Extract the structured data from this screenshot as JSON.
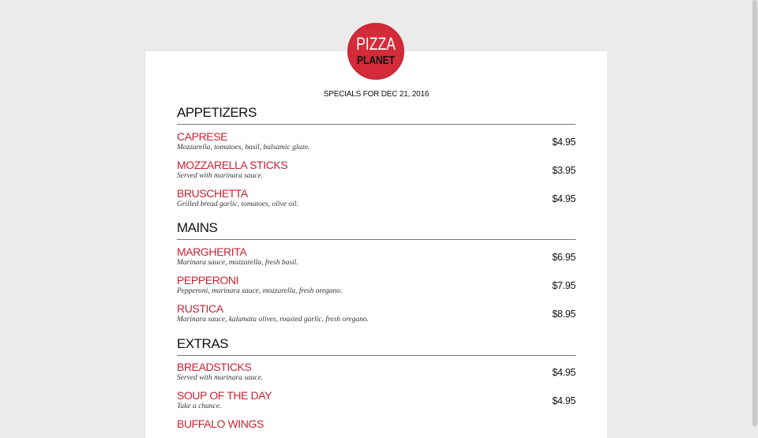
{
  "logo": {
    "line1": "PIZZA",
    "line2": "PLANET"
  },
  "specials": "SPECIALS FOR DEC 21, 2016",
  "colors": {
    "accent": "#d42a3a",
    "item_name": "#c82333"
  },
  "sections": [
    {
      "title": "APPETIZERS",
      "items": [
        {
          "name": "CAPRESE",
          "desc": "Mozzarella, tomatoes, basil, balsamic glaze.",
          "price": "$4.95"
        },
        {
          "name": "MOZZARELLA STICKS",
          "desc": "Served with marinara sauce.",
          "price": "$3.95"
        },
        {
          "name": "BRUSCHETTA",
          "desc": "Grilled bread garlic, tomatoes, olive oil.",
          "price": "$4.95"
        }
      ]
    },
    {
      "title": "MAINS",
      "items": [
        {
          "name": "MARGHERITA",
          "desc": "Marinara sauce, mozzarella, fresh basil.",
          "price": "$6.95"
        },
        {
          "name": "PEPPERONI",
          "desc": "Pepperoni, marinara sauce, mozzarella, fresh oregano.",
          "price": "$7.95"
        },
        {
          "name": "RUSTICA",
          "desc": "Marinara sauce, kalamata olives, roasted garlic, fresh oregano.",
          "price": "$8.95"
        }
      ]
    },
    {
      "title": "EXTRAS",
      "items": [
        {
          "name": "BREADSTICKS",
          "desc": "Served with marinara sauce.",
          "price": "$4.95"
        },
        {
          "name": "SOUP OF THE DAY",
          "desc": "Take a chance.",
          "price": "$4.95"
        },
        {
          "name": "BUFFALO WINGS",
          "desc": "",
          "price": ""
        }
      ]
    }
  ]
}
